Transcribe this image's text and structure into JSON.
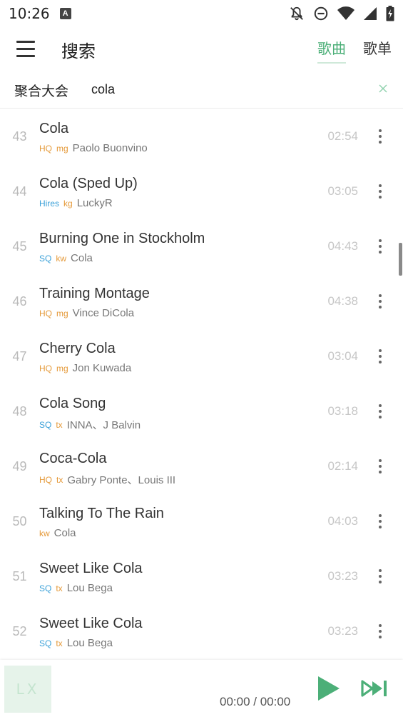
{
  "status_bar": {
    "time": "10:26",
    "notification_icon_letter": "A",
    "icons": [
      "bell-off-icon",
      "do-not-disturb-icon",
      "wifi-icon",
      "signal-icon",
      "battery-charging-icon"
    ]
  },
  "header": {
    "title": "搜索",
    "tabs": [
      {
        "label": "歌曲",
        "active": true
      },
      {
        "label": "歌单",
        "active": false
      }
    ]
  },
  "search": {
    "source": "聚合大会",
    "query": "cola"
  },
  "colors": {
    "accent": "#4caf78",
    "quality_hq": "#e59a3a",
    "quality_sq": "#3aa0d8",
    "source_badge": "#e59a3a"
  },
  "songs": [
    {
      "num": "43",
      "title": "Cola",
      "quality": "HQ",
      "source": "mg",
      "artist": "Paolo Buonvino",
      "duration": "02:54"
    },
    {
      "num": "44",
      "title": "Cola (Sped Up)",
      "quality": "Hires",
      "source": "kg",
      "artist": "LuckyR",
      "duration": "03:05"
    },
    {
      "num": "45",
      "title": "Burning One in Stockholm",
      "quality": "SQ",
      "source": "kw",
      "artist": "Cola",
      "duration": "04:43"
    },
    {
      "num": "46",
      "title": "Training Montage",
      "quality": "HQ",
      "source": "mg",
      "artist": "Vince DiCola",
      "duration": "04:38"
    },
    {
      "num": "47",
      "title": "Cherry Cola",
      "quality": "HQ",
      "source": "mg",
      "artist": "Jon Kuwada",
      "duration": "03:04"
    },
    {
      "num": "48",
      "title": "Cola Song",
      "quality": "SQ",
      "source": "tx",
      "artist": "INNA、J Balvin",
      "duration": "03:18"
    },
    {
      "num": "49",
      "title": "Coca-Cola",
      "quality": "HQ",
      "source": "tx",
      "artist": "Gabry Ponte、Louis III",
      "duration": "02:14"
    },
    {
      "num": "50",
      "title": "Talking To The Rain",
      "quality": "",
      "source": "kw",
      "artist": "Cola",
      "duration": "04:03"
    },
    {
      "num": "51",
      "title": "Sweet Like Cola",
      "quality": "SQ",
      "source": "tx",
      "artist": "Lou Bega",
      "duration": "03:23"
    },
    {
      "num": "52",
      "title": "Sweet Like Cola",
      "quality": "SQ",
      "source": "tx",
      "artist": "Lou Bega",
      "duration": "03:23"
    }
  ],
  "player": {
    "cover_text": "LX",
    "time": "00:00 / 00:00"
  }
}
